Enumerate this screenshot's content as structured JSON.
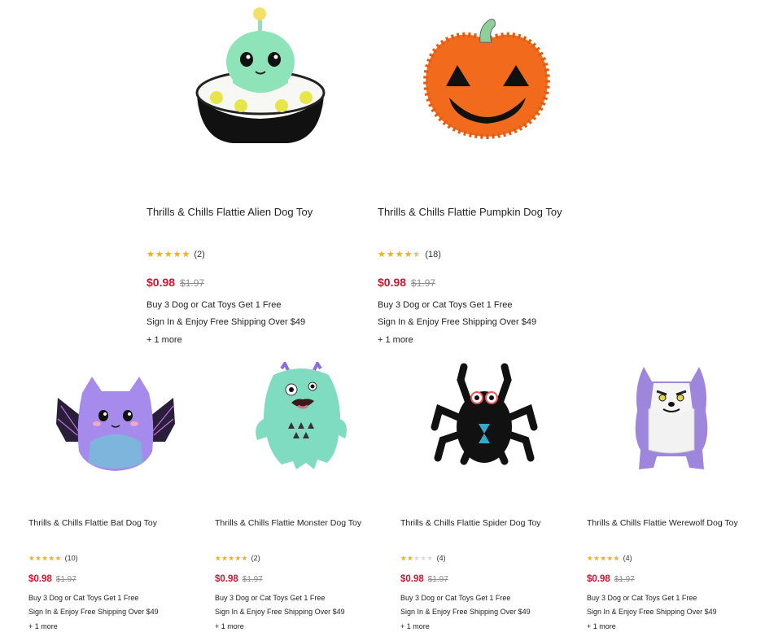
{
  "products": [
    {
      "name": "Thrills & Chills Flattie Alien Dog Toy",
      "image": "alien-plush-toy",
      "rating": 5,
      "review_count": "(2)",
      "sale_price": "$0.98",
      "original_price": "$1.97",
      "promos": [
        "Buy 3 Dog or Cat Toys Get 1 Free",
        "Sign In & Enjoy Free Shipping Over $49"
      ],
      "more": "+ 1 more"
    },
    {
      "name": "Thrills & Chills Flattie Pumpkin Dog Toy",
      "image": "pumpkin-plush-toy",
      "rating": 4.5,
      "review_count": "(18)",
      "sale_price": "$0.98",
      "original_price": "$1.97",
      "promos": [
        "Buy 3 Dog or Cat Toys Get 1 Free",
        "Sign In & Enjoy Free Shipping Over $49"
      ],
      "more": "+ 1 more"
    },
    {
      "name": "Thrills & Chills Flattie Bat Dog Toy",
      "image": "bat-plush-toy",
      "rating": 5,
      "review_count": "(10)",
      "sale_price": "$0.98",
      "original_price": "$1.97",
      "promos": [
        "Buy 3 Dog or Cat Toys Get 1 Free",
        "Sign In & Enjoy Free Shipping Over $49"
      ],
      "more": "+ 1 more"
    },
    {
      "name": "Thrills & Chills Flattie Monster Dog Toy",
      "image": "monster-plush-toy",
      "rating": 5,
      "review_count": "(2)",
      "sale_price": "$0.98",
      "original_price": "$1.97",
      "promos": [
        "Buy 3 Dog or Cat Toys Get 1 Free",
        "Sign In & Enjoy Free Shipping Over $49"
      ],
      "more": "+ 1 more"
    },
    {
      "name": "Thrills & Chills Flattie Spider Dog Toy",
      "image": "spider-plush-toy",
      "rating": 2,
      "review_count": "(4)",
      "sale_price": "$0.98",
      "original_price": "$1.97",
      "promos": [
        "Buy 3 Dog or Cat Toys Get 1 Free",
        "Sign In & Enjoy Free Shipping Over $49"
      ],
      "more": "+ 1 more"
    },
    {
      "name": "Thrills & Chills Flattie Werewolf Dog Toy",
      "image": "werewolf-plush-toy",
      "rating": 5,
      "review_count": "(4)",
      "sale_price": "$0.98",
      "original_price": "$1.97",
      "promos": [
        "Buy 3 Dog or Cat Toys Get 1 Free",
        "Sign In & Enjoy Free Shipping Over $49"
      ],
      "more": "+ 1 more"
    }
  ],
  "colors": {
    "sale": "#d3132f",
    "star": "#f5b301",
    "star_empty": "#d8d8d8"
  }
}
